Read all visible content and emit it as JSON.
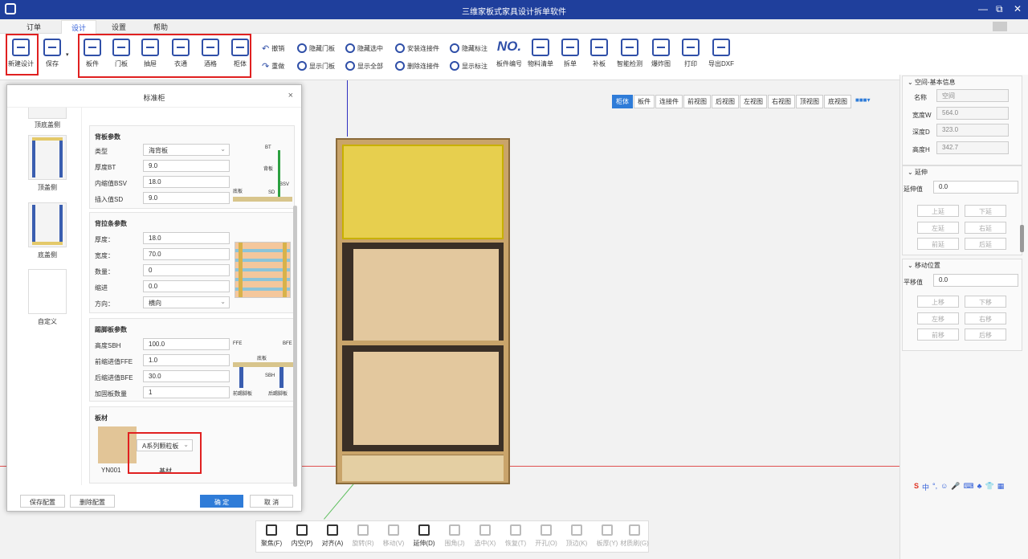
{
  "app": {
    "title": "三维家板式家具设计拆单软件",
    "window_controls": [
      "—",
      "⧉",
      "✕"
    ]
  },
  "menu": [
    "订单",
    "设计",
    "设置",
    "帮助"
  ],
  "ribbon": {
    "file": [
      "新建设计",
      "保存"
    ],
    "cabinets": [
      "板件",
      "门板",
      "抽屉",
      "衣通",
      "酒格",
      "柜体"
    ],
    "small": [
      "撤销",
      "重做",
      "隐藏门板",
      "显示门板",
      "隐藏选中",
      "显示全部",
      "安装连接件",
      "删除连接件",
      "隐藏标注",
      "显示标注"
    ],
    "big": [
      "板件编号",
      "物料清单",
      "拆单",
      "补板",
      "智能检测",
      "爆炸图",
      "打印",
      "导出DXF"
    ],
    "no_label": "NO."
  },
  "viewtabs": [
    "柜体",
    "板件",
    "连接件",
    "前视图",
    "后视图",
    "左视图",
    "右视图",
    "顶视图",
    "底视图"
  ],
  "right": {
    "basic": {
      "title": "空间-基本信息",
      "name_lbl": "名称",
      "name": "空间",
      "w_lbl": "宽度W",
      "w": "564.0",
      "d_lbl": "深度D",
      "d": "323.0",
      "h_lbl": "高度H",
      "h": "342.7"
    },
    "extend": {
      "title": "延伸",
      "val_lbl": "延伸值",
      "val": "0.0",
      "btns": [
        "上延",
        "下延",
        "左延",
        "右延",
        "前延",
        "后延"
      ]
    },
    "move": {
      "title": "移动位置",
      "val_lbl": "平移值",
      "val": "0.0",
      "btns": [
        "上移",
        "下移",
        "左移",
        "右移",
        "前移",
        "后移"
      ]
    }
  },
  "dialog": {
    "title": "标准柜",
    "thumbs": [
      "顶底盖侧",
      "顶盖侧",
      "底盖侧",
      "自定义"
    ],
    "back": {
      "title": "背板参数",
      "type_lbl": "类型",
      "type": "海背板",
      "bt_lbl": "厚度BT",
      "bt": "9.0",
      "bsv_lbl": "内缩值BSV",
      "bsv": "18.0",
      "sd_lbl": "插入值SD",
      "sd": "9.0",
      "diag": [
        "BT",
        "背板",
        "BSV",
        "底板",
        "SD"
      ]
    },
    "strip": {
      "title": "背拉条参数",
      "th_lbl": "厚度：",
      "th": "18.0",
      "wd_lbl": "宽度：",
      "wd": "70.0",
      "num_lbl": "数量：",
      "num": "0",
      "in_lbl": "缩进",
      "in": "0.0",
      "dir_lbl": "方向：",
      "dir": "横向"
    },
    "kick": {
      "title": "踢脚板参数",
      "sbh_lbl": "高度SBH",
      "sbh": "100.0",
      "ffe_lbl": "前缩进值FFE",
      "ffe": "1.0",
      "bfe_lbl": "后缩进值BFE",
      "bfe": "30.0",
      "cnt_lbl": "加固板数量",
      "cnt": "1",
      "diag": [
        "FFE",
        "BFE",
        "底板",
        "SBH",
        "前踢脚板",
        "后踢脚板"
      ]
    },
    "mat": {
      "title": "板材",
      "code": "YN001",
      "series": "A系列颗粒板",
      "base": "基材"
    },
    "buttons": [
      "保存配置",
      "删除配置",
      "确 定",
      "取 消"
    ]
  },
  "toolbar": [
    {
      "l": "聚焦(F)",
      "d": false
    },
    {
      "l": "内空(P)",
      "d": false
    },
    {
      "l": "对齐(A)",
      "d": false
    },
    {
      "l": "旋转(R)",
      "d": true
    },
    {
      "l": "移动(V)",
      "d": true
    },
    {
      "l": "延伸(D)",
      "d": false
    },
    {
      "l": "围角(J)",
      "d": true
    },
    {
      "l": "选中(X)",
      "d": true
    },
    {
      "l": "恢复(T)",
      "d": true
    },
    {
      "l": "开孔(O)",
      "d": true
    },
    {
      "l": "顶边(K)",
      "d": true
    },
    {
      "l": "板厚(Y)",
      "d": true
    },
    {
      "l": "材质刷(G)",
      "d": true
    }
  ],
  "ime": [
    "中",
    "°,",
    "☺",
    "🎤",
    "⌨",
    "♣",
    "👕",
    "▦"
  ]
}
